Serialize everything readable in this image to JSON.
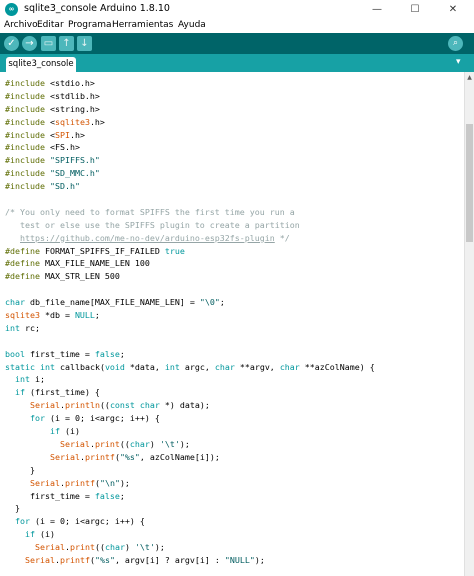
{
  "window": {
    "title": "sqlite3_console Arduino 1.8.10",
    "icon": "arduino-logo",
    "controls": [
      "—",
      "☐",
      "✕"
    ]
  },
  "menu": [
    "Archivo",
    "Editar",
    "Programa",
    "Herramientas",
    "Ayuda"
  ],
  "toolbar": {
    "buttons": [
      {
        "name": "verify",
        "icon": "✓"
      },
      {
        "name": "upload",
        "icon": "→"
      },
      {
        "name": "new",
        "icon": "▭"
      },
      {
        "name": "open",
        "icon": "↑"
      },
      {
        "name": "save",
        "icon": "↓"
      }
    ],
    "serial_monitor_icon": "⌕",
    "accent_color": "#006468"
  },
  "tabs": [
    {
      "label": "sqlite3_console"
    }
  ],
  "tab_menu_icon": "▾",
  "code_lines": [
    [
      [
        "pre",
        "#include "
      ],
      [
        "",
        "<stdio.h>"
      ]
    ],
    [
      [
        "pre",
        "#include "
      ],
      [
        "",
        "<stdlib.h>"
      ]
    ],
    [
      [
        "pre",
        "#include "
      ],
      [
        "",
        "<string.h>"
      ]
    ],
    [
      [
        "pre",
        "#include "
      ],
      [
        "",
        "<"
      ],
      [
        "fn",
        "sqlite3"
      ],
      [
        "",
        ".h>"
      ]
    ],
    [
      [
        "pre",
        "#include "
      ],
      [
        "",
        "<"
      ],
      [
        "fn",
        "SPI"
      ],
      [
        "",
        ".h>"
      ]
    ],
    [
      [
        "pre",
        "#include "
      ],
      [
        "",
        "<FS.h>"
      ]
    ],
    [
      [
        "pre",
        "#include "
      ],
      [
        "str",
        "\"SPIFFS.h\""
      ]
    ],
    [
      [
        "pre",
        "#include "
      ],
      [
        "str",
        "\"SD_MMC.h\""
      ]
    ],
    [
      [
        "pre",
        "#include "
      ],
      [
        "str",
        "\"SD.h\""
      ]
    ],
    [],
    [
      [
        "cmt",
        "/* You only need to format SPIFFS the first time you run a"
      ]
    ],
    [
      [
        "cmt",
        "   test or else use the SPIFFS plugin to create a partition"
      ]
    ],
    [
      [
        "cmt",
        "   "
      ],
      [
        "link",
        "https://github.com/me-no-dev/arduino-esp32fs-plugin"
      ],
      [
        "cmt",
        " */"
      ]
    ],
    [
      [
        "pre",
        "#define "
      ],
      [
        "",
        "FORMAT_SPIFFS_IF_FAILED "
      ],
      [
        "kw",
        "true"
      ]
    ],
    [
      [
        "pre",
        "#define "
      ],
      [
        "",
        "MAX_FILE_NAME_LEN 100"
      ]
    ],
    [
      [
        "pre",
        "#define "
      ],
      [
        "",
        "MAX_STR_LEN 500"
      ]
    ],
    [],
    [
      [
        "kw",
        "char"
      ],
      [
        "",
        " db_file_name[MAX_FILE_NAME_LEN] = "
      ],
      [
        "str",
        "\"\\0\""
      ],
      [
        "",
        ";"
      ]
    ],
    [
      [
        "fn",
        "sqlite3"
      ],
      [
        "",
        " *db = "
      ],
      [
        "kw",
        "NULL"
      ],
      [
        "",
        ";"
      ]
    ],
    [
      [
        "kw",
        "int"
      ],
      [
        "",
        " rc;"
      ]
    ],
    [],
    [
      [
        "kw",
        "bool"
      ],
      [
        "",
        " first_time = "
      ],
      [
        "kw",
        "false"
      ],
      [
        "",
        ";"
      ]
    ],
    [
      [
        "kw",
        "static"
      ],
      [
        "",
        " "
      ],
      [
        "kw",
        "int"
      ],
      [
        "",
        " callback("
      ],
      [
        "kw",
        "void"
      ],
      [
        "",
        " *data, "
      ],
      [
        "kw",
        "int"
      ],
      [
        "",
        " argc, "
      ],
      [
        "kw",
        "char"
      ],
      [
        "",
        " **argv, "
      ],
      [
        "kw",
        "char"
      ],
      [
        "",
        " **azColName) {"
      ]
    ],
    [
      [
        "",
        "  "
      ],
      [
        "kw",
        "int"
      ],
      [
        "",
        " i;"
      ]
    ],
    [
      [
        "",
        "  "
      ],
      [
        "kw",
        "if"
      ],
      [
        "",
        " (first_time) {"
      ]
    ],
    [
      [
        "",
        "     "
      ],
      [
        "fn",
        "Serial"
      ],
      [
        "",
        "."
      ],
      [
        "fn",
        "println"
      ],
      [
        "",
        "(("
      ],
      [
        "kw",
        "const"
      ],
      [
        "",
        " "
      ],
      [
        "kw",
        "char"
      ],
      [
        "",
        " *) data);"
      ]
    ],
    [
      [
        "",
        "     "
      ],
      [
        "kw",
        "for"
      ],
      [
        "",
        " (i = 0; i<argc; i++) {"
      ]
    ],
    [
      [
        "",
        "         "
      ],
      [
        "kw",
        "if"
      ],
      [
        "",
        " (i)"
      ]
    ],
    [
      [
        "",
        "           "
      ],
      [
        "fn",
        "Serial"
      ],
      [
        "",
        "."
      ],
      [
        "fn",
        "print"
      ],
      [
        "",
        "(("
      ],
      [
        "kw",
        "char"
      ],
      [
        "",
        ") "
      ],
      [
        "str",
        "'\\t'"
      ],
      [
        "",
        ");"
      ]
    ],
    [
      [
        "",
        "         "
      ],
      [
        "fn",
        "Serial"
      ],
      [
        "",
        "."
      ],
      [
        "fn",
        "printf"
      ],
      [
        "",
        "("
      ],
      [
        "str",
        "\"%s\""
      ],
      [
        "",
        ", azColName[i]);"
      ]
    ],
    [
      [
        "",
        "     }"
      ]
    ],
    [
      [
        "",
        "     "
      ],
      [
        "fn",
        "Serial"
      ],
      [
        "",
        "."
      ],
      [
        "fn",
        "printf"
      ],
      [
        "",
        "("
      ],
      [
        "str",
        "\"\\n\""
      ],
      [
        "",
        ");"
      ]
    ],
    [
      [
        "",
        "     first_time = "
      ],
      [
        "kw",
        "false"
      ],
      [
        "",
        ";"
      ]
    ],
    [
      [
        "",
        "  }"
      ]
    ],
    [
      [
        "",
        "  "
      ],
      [
        "kw",
        "for"
      ],
      [
        "",
        " (i = 0; i<argc; i++) {"
      ]
    ],
    [
      [
        "",
        "    "
      ],
      [
        "kw",
        "if"
      ],
      [
        "",
        " (i)"
      ]
    ],
    [
      [
        "",
        "      "
      ],
      [
        "fn",
        "Serial"
      ],
      [
        "",
        "."
      ],
      [
        "fn",
        "print"
      ],
      [
        "",
        "(("
      ],
      [
        "kw",
        "char"
      ],
      [
        "",
        ") "
      ],
      [
        "str",
        "'\\t'"
      ],
      [
        "",
        ");"
      ]
    ],
    [
      [
        "",
        "    "
      ],
      [
        "fn",
        "Serial"
      ],
      [
        "",
        "."
      ],
      [
        "fn",
        "printf"
      ],
      [
        "",
        "("
      ],
      [
        "str",
        "\"%s\""
      ],
      [
        "",
        ", argv[i] ? argv[i] : "
      ],
      [
        "str",
        "\"NULL\""
      ],
      [
        "",
        ");"
      ]
    ]
  ],
  "colors": {
    "keyword": "#00979c",
    "string": "#005c5f",
    "function": "#d35400",
    "comment": "#95a5a6",
    "preprocessor": "#5e6d03",
    "tabbar": "#17a1a5"
  }
}
